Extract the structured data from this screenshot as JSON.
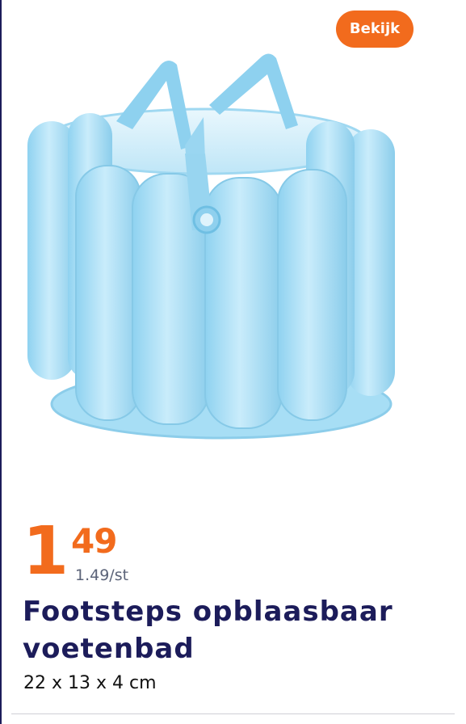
{
  "header": {
    "view_button_label": "Bekijk"
  },
  "product": {
    "image_icon": "inflatable-foot-bath-image",
    "price_main": "1",
    "price_cents": "49",
    "unit_price": "1.49/st",
    "title": "Footsteps opblaasbaar voetenbad",
    "dimensions": "22 x 13 x 4 cm"
  },
  "colors": {
    "accent": "#f26b1d",
    "title": "#1c1c5a",
    "product_blue": "#a9dff5"
  }
}
